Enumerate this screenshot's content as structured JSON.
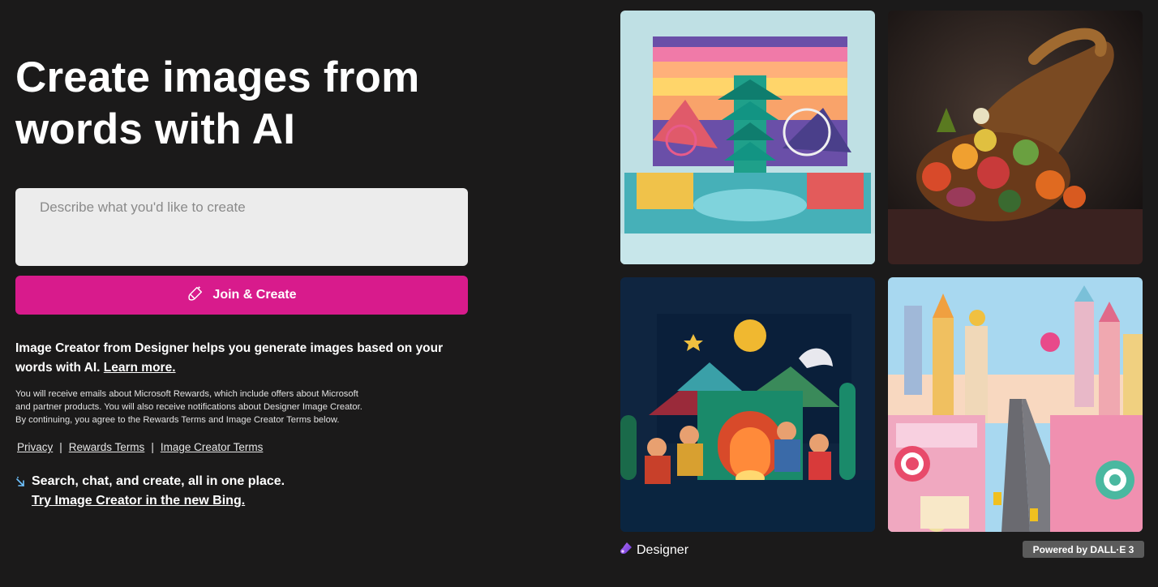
{
  "hero": {
    "headline_line1": "Create images from",
    "headline_line2": "words with AI"
  },
  "prompt": {
    "placeholder": "Describe what you'd like to create",
    "value": ""
  },
  "join_button": {
    "label": "Join & Create",
    "icon": "magic-brush-icon",
    "color": "#d81b8c"
  },
  "description": {
    "text": "Image Creator from Designer helps you generate images based on your words with AI.",
    "learn_more": "Learn more."
  },
  "fine_print": {
    "line1": "You will receive emails about Microsoft Rewards, which include offers about Microsoft",
    "line2": "and partner products. You will also receive notifications about Designer Image Creator.",
    "line3": "By continuing, you agree to the Rewards Terms and Image Creator Terms below."
  },
  "links": {
    "privacy": "Privacy",
    "separator": "|",
    "rewards_terms": "Rewards Terms",
    "image_creator_terms": "Image Creator Terms"
  },
  "promo": {
    "icon": "arrow-sparkle-icon",
    "text": "Search, chat, and create, all in one place.",
    "link": "Try Image Creator in the new Bing."
  },
  "gallery": {
    "images": [
      {
        "name": "paper-craft-pagoda-amusement-park"
      },
      {
        "name": "cornucopia-fruit-still-life"
      },
      {
        "name": "felt-campfire-night-scene"
      },
      {
        "name": "candy-city-street"
      }
    ]
  },
  "footer": {
    "designer_label": "Designer",
    "designer_icon": "designer-logo-icon",
    "powered_by": "Powered by DALL·E 3"
  },
  "colors": {
    "background": "#1b1a1a",
    "accent": "#d81b8c",
    "input_bg": "#ececec"
  }
}
